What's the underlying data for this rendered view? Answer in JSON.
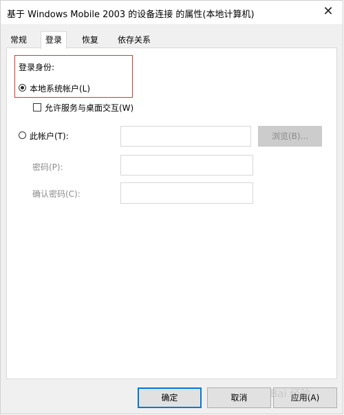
{
  "window": {
    "title": "基于 Windows Mobile 2003 的设备连接 的属性(本地计算机)",
    "close_glyph": "✕"
  },
  "tabs": [
    {
      "label": "常规",
      "active": false
    },
    {
      "label": "登录",
      "active": true
    },
    {
      "label": "恢复",
      "active": false
    },
    {
      "label": "依存关系",
      "active": false
    }
  ],
  "logon": {
    "section_label": "登录身份:",
    "local_system_option": "本地系统帐户(L)",
    "local_system_selected": true,
    "allow_desktop_interaction": "允许服务与桌面交互(W)",
    "allow_desktop_checked": false,
    "this_account_option": "此帐户(T):",
    "this_account_selected": false,
    "account_value": "",
    "browse_label": "浏览(B)...",
    "password_label": "密码(P):",
    "password_value": "",
    "confirm_password_label": "确认密码(C):",
    "confirm_password_value": ""
  },
  "buttons": {
    "ok": "确定",
    "cancel": "取消",
    "apply": "应用(A)"
  },
  "watermark": {
    "text": "Bai 经验"
  },
  "colors": {
    "highlight_box": "#e03232",
    "primary_border": "#0078d7"
  }
}
